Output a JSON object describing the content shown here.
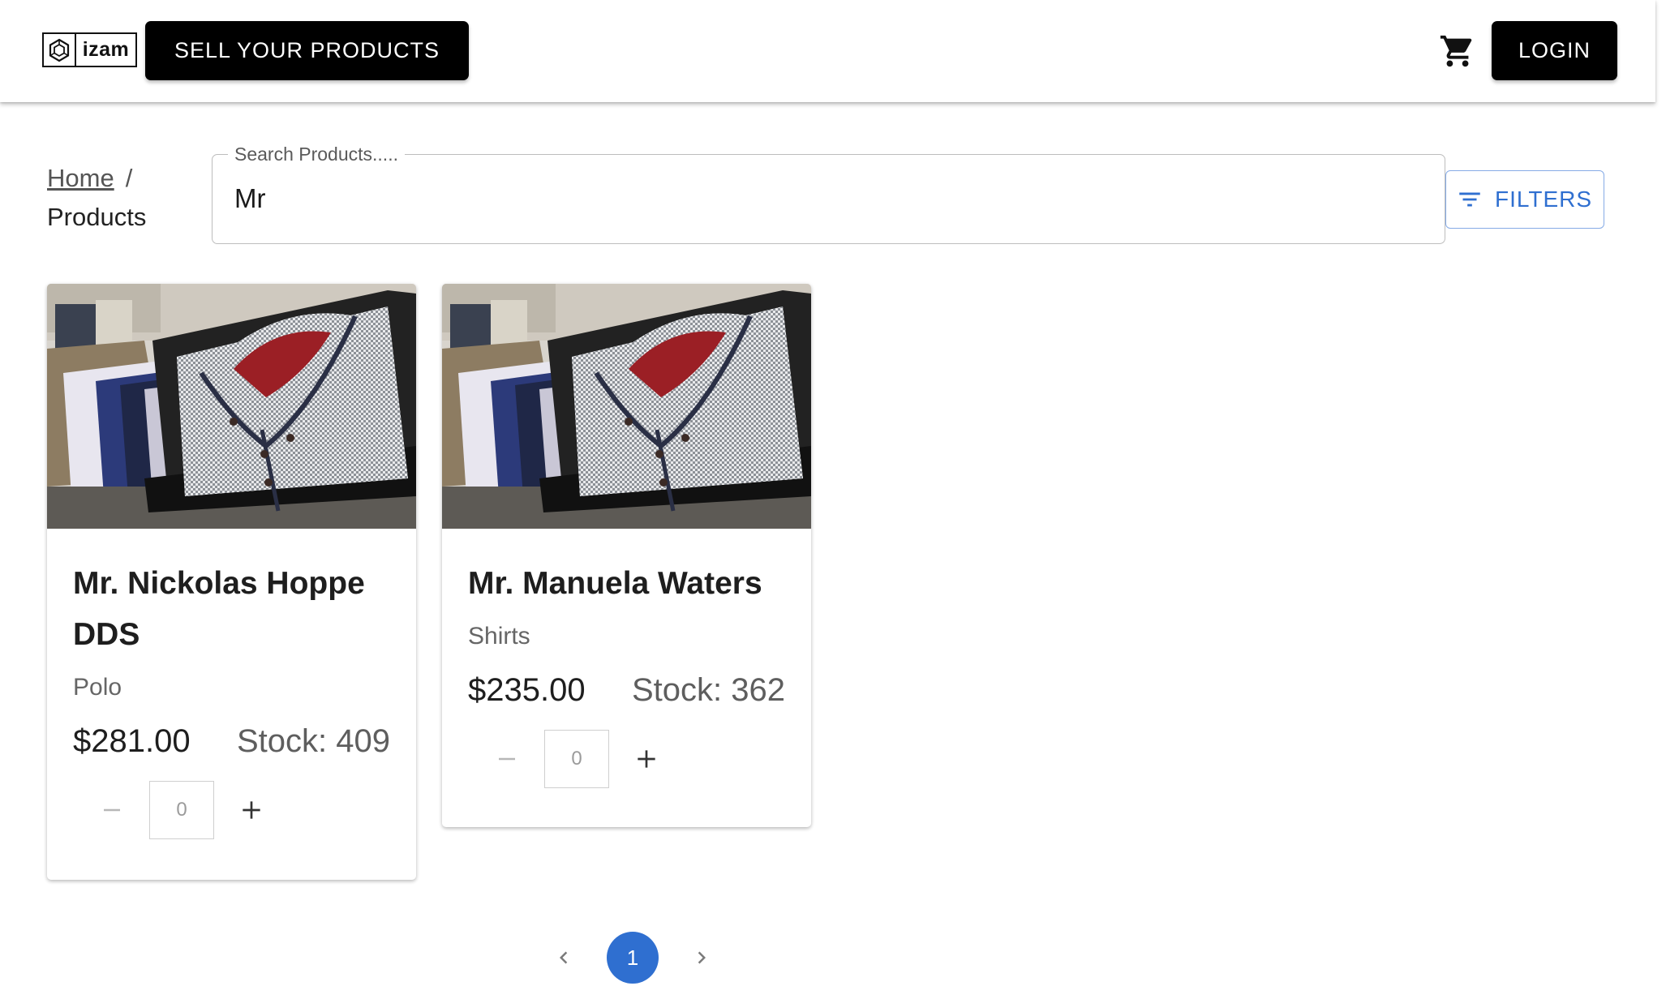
{
  "header": {
    "logo_text": "izam",
    "sell_button": "SELL YOUR PRODUCTS",
    "cart_icon": "shopping-cart-icon",
    "login_button": "LOGIN"
  },
  "breadcrumb": {
    "home": "Home",
    "separator": "/",
    "current": "Products"
  },
  "search": {
    "label": "Search Products.....",
    "value": "Mr"
  },
  "filters": {
    "label": "FILTERS",
    "icon": "filter-list-icon"
  },
  "products": [
    {
      "title": "Mr. Nickolas Hoppe DDS",
      "category": "Polo",
      "price": "$281.00",
      "stock": "Stock: 409",
      "quantity": "0"
    },
    {
      "title": "Mr. Manuela Waters",
      "category": "Shirts",
      "price": "$235.00",
      "stock": "Stock: 362",
      "quantity": "0"
    }
  ],
  "pagination": {
    "current_page": "1"
  },
  "colors": {
    "accent": "#2f6fd0",
    "header_buttons": "#000000"
  }
}
